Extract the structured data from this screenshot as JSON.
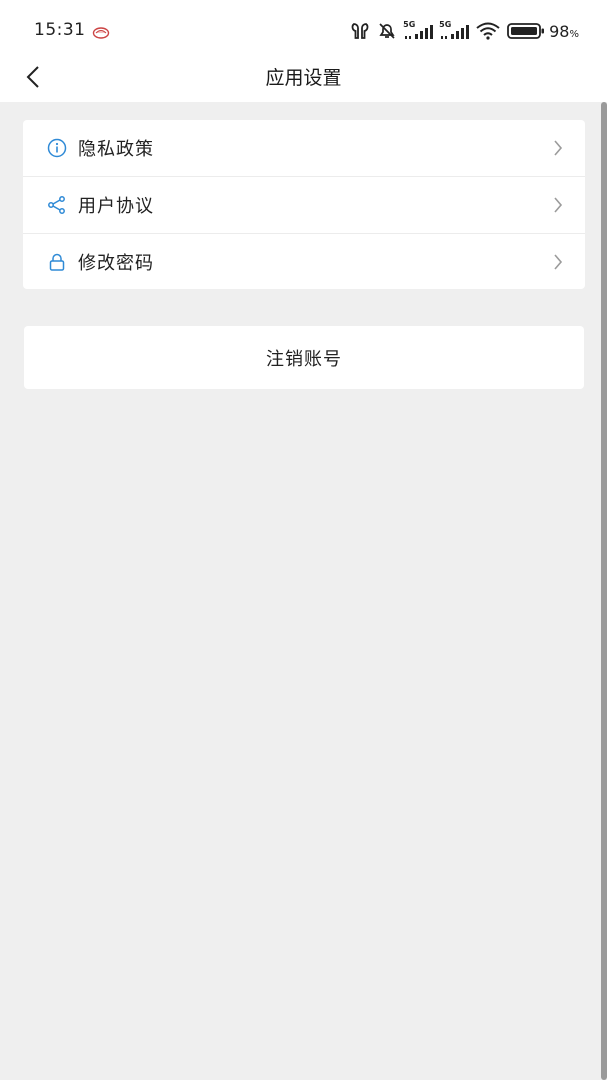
{
  "status_bar": {
    "time": "15:31",
    "network_1": "5G",
    "network_2": "5G",
    "battery_percent": "98",
    "battery_unit": "%"
  },
  "header": {
    "title": "应用设置",
    "back_icon": "chevron-left-icon"
  },
  "menu": {
    "items": [
      {
        "label": "隐私政策",
        "icon": "info-icon"
      },
      {
        "label": "用户协议",
        "icon": "share-icon"
      },
      {
        "label": "修改密码",
        "icon": "lock-icon"
      }
    ]
  },
  "logout": {
    "label": "注销账号"
  },
  "colors": {
    "accent": "#2f8ad6",
    "background": "#efefef",
    "card": "#ffffff",
    "chevron": "#9b9b9b"
  }
}
